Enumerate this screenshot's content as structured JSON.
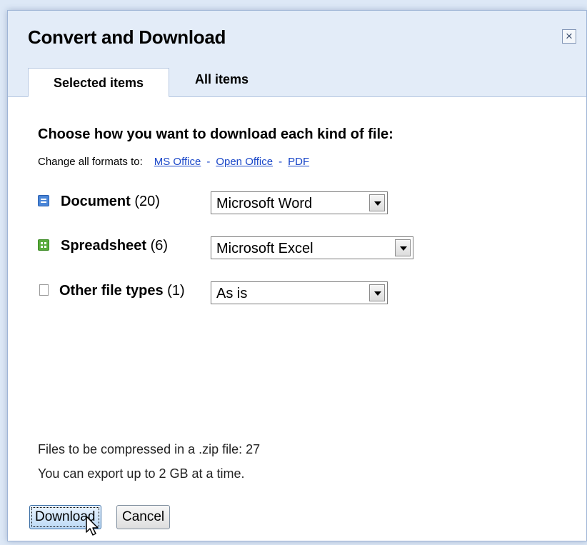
{
  "dialog": {
    "title": "Convert and Download",
    "close_label": "×"
  },
  "tabs": [
    {
      "label": "Selected items",
      "active": true
    },
    {
      "label": "All items",
      "active": false
    }
  ],
  "heading": "Choose how you want to download each kind of file:",
  "change_formats": {
    "label": "Change all formats to:",
    "links": [
      "MS Office",
      "Open Office",
      "PDF"
    ],
    "separator": "-"
  },
  "file_types": [
    {
      "icon": "document-icon",
      "name": "Document",
      "count": "(20)",
      "format": "Microsoft Word"
    },
    {
      "icon": "spreadsheet-icon",
      "name": "Spreadsheet",
      "count": "(6)",
      "format": "Microsoft Excel"
    },
    {
      "icon": "file-icon",
      "name": "Other file types",
      "count": "(1)",
      "format": "As is"
    }
  ],
  "info": {
    "compressed": "Files to be compressed in a .zip file: 27",
    "limit": "You can export up to 2 GB at a time."
  },
  "buttons": {
    "download": "Download",
    "cancel": "Cancel"
  }
}
